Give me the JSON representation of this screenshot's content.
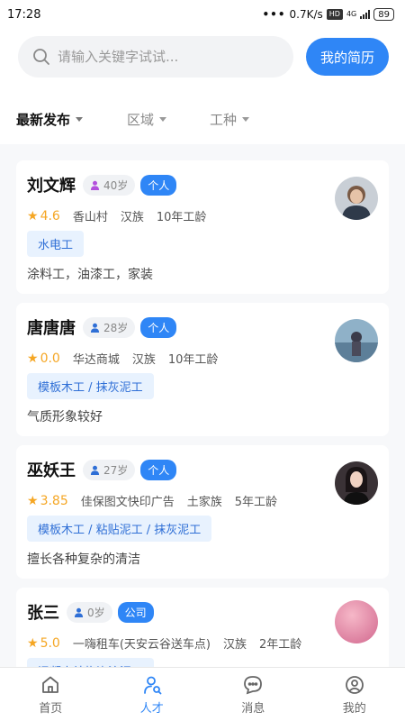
{
  "status": {
    "time": "17:28",
    "speed": "0.7K/s",
    "hd": "HD",
    "net": "4G",
    "battery": "89"
  },
  "search": {
    "placeholder": "请输入关键字试试...",
    "resume_label": "我的简历"
  },
  "filters": [
    {
      "label": "最新发布",
      "active": true
    },
    {
      "label": "区域",
      "active": false
    },
    {
      "label": "工种",
      "active": false
    }
  ],
  "workers": [
    {
      "name": "刘文辉",
      "age": "40岁",
      "gender": "female",
      "type": "个人",
      "rating": "4.6",
      "location": "香山村",
      "ethnicity": "汉族",
      "experience": "10年工龄",
      "skills": "水电工",
      "description": "涂料工，油漆工，家装"
    },
    {
      "name": "唐唐唐",
      "age": "28岁",
      "gender": "male",
      "type": "个人",
      "rating": "0.0",
      "location": "华达商城",
      "ethnicity": "汉族",
      "experience": "10年工龄",
      "skills": "模板木工 / 抹灰泥工",
      "description": "气质形象较好"
    },
    {
      "name": "巫妖王",
      "age": "27岁",
      "gender": "male",
      "type": "个人",
      "rating": "3.85",
      "location": "佳保图文快印广告",
      "ethnicity": "土家族",
      "experience": "5年工龄",
      "skills": "模板木工 / 粘贴泥工 / 抹灰泥工",
      "description": "擅长各种复杂的清洁"
    },
    {
      "name": "张三",
      "age": "0岁",
      "gender": "male",
      "type": "公司",
      "rating": "5.0",
      "location": "一嗨租车(天安云谷送车点)",
      "ethnicity": "汉族",
      "experience": "2年工龄",
      "skills": "混凝土结构浇注泥工",
      "description": ""
    }
  ],
  "tabs": [
    {
      "label": "首页",
      "icon": "home-icon"
    },
    {
      "label": "人才",
      "icon": "talent-icon",
      "active": true
    },
    {
      "label": "消息",
      "icon": "message-icon"
    },
    {
      "label": "我的",
      "icon": "profile-icon"
    }
  ],
  "colors": {
    "accent": "#2f86f6",
    "star": "#f5a623",
    "female": "#b24fdc",
    "male": "#2f6fd6",
    "tag_bg": "#e8f2fe"
  }
}
